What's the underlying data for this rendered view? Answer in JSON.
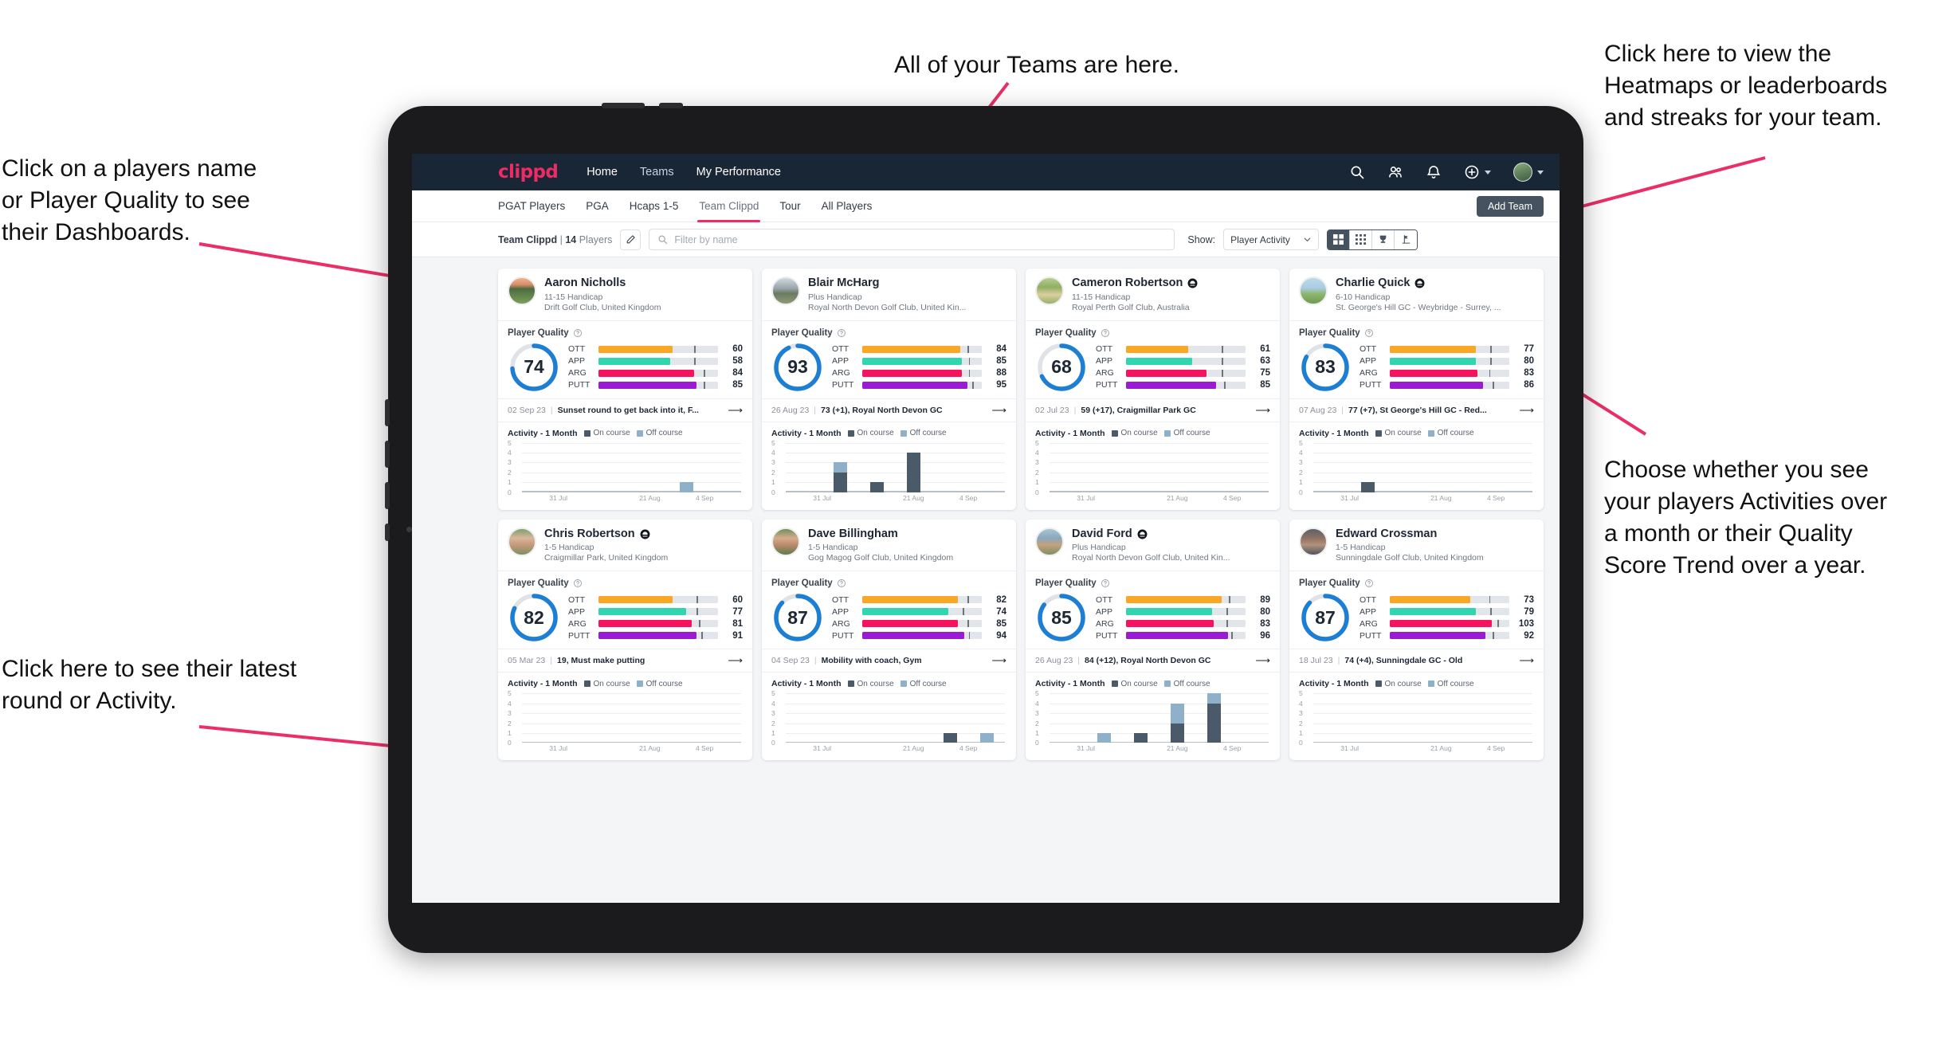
{
  "annotations": {
    "players": "Click on a players name\nor Player Quality to see\ntheir Dashboards.",
    "latest": "Click here to see their latest\nround or Activity.",
    "teams": "All of your Teams are here.",
    "heatmap": "Click here to view the\nHeatmaps or leaderboards\nand streaks for your team.",
    "choose": "Choose whether you see\nyour players Activities over\na month or their Quality\nScore Trend over a year."
  },
  "colors": {
    "brand_pink": "#ee2b62",
    "navbar": "#182636",
    "ott": "#f9a825",
    "app": "#31d6b0",
    "arg": "#f5125f",
    "putt": "#9b1bd4",
    "ring": "#1d7fd4",
    "on_course": "#4a5a69",
    "off_course": "#8fb0c9"
  },
  "topnav": {
    "brand": "clippd",
    "links": [
      {
        "label": "Home",
        "active": true
      },
      {
        "label": "Teams",
        "active": false
      },
      {
        "label": "My Performance",
        "active": true
      }
    ],
    "icons": [
      "search-icon",
      "people-icon",
      "bell-icon",
      "plus-circle-icon",
      "avatar"
    ]
  },
  "subnav": {
    "tabs": [
      {
        "label": "PGAT Players",
        "active": false
      },
      {
        "label": "PGA",
        "active": false
      },
      {
        "label": "Hcaps 1-5",
        "active": false
      },
      {
        "label": "Team Clippd",
        "active": true
      },
      {
        "label": "Tour",
        "active": false
      },
      {
        "label": "All Players",
        "active": false
      }
    ],
    "add_team_label": "Add Team"
  },
  "filterbar": {
    "team_name": "Team Clippd",
    "separator": "|",
    "player_count": "14",
    "players_word": "Players",
    "edit_icon": "pencil-icon",
    "search_placeholder": "Filter by name",
    "show_label": "Show:",
    "show_value": "Player Activity",
    "view_modes": [
      {
        "name": "grid-large-view",
        "active": true
      },
      {
        "name": "grid-small-view",
        "active": false
      },
      {
        "name": "trophy-leaderboard-view",
        "active": false
      },
      {
        "name": "golf-flag-view",
        "active": false
      }
    ]
  },
  "card_labels": {
    "player_quality": "Player Quality",
    "activity_title": "Activity - 1 Month",
    "legend_on": "On course",
    "legend_off": "Off course",
    "bars": [
      "OTT",
      "APP",
      "ARG",
      "PUTT"
    ],
    "y_ticks": [
      "5",
      "4",
      "3",
      "2",
      "1",
      "0"
    ],
    "x_ticks": [
      "31 Jul",
      "21 Aug",
      "4 Sep"
    ]
  },
  "players": [
    {
      "name": "Aaron Nicholls",
      "verified": false,
      "handicap": "11-15 Handicap",
      "club": "Drift Golf Club, United Kingdom",
      "quality": 74,
      "metrics": [
        {
          "label": "OTT",
          "value": 60,
          "fill": 62,
          "tick": 80
        },
        {
          "label": "APP",
          "value": 58,
          "fill": 60,
          "tick": 80
        },
        {
          "label": "ARG",
          "value": 84,
          "fill": 80,
          "tick": 88
        },
        {
          "label": "PUTT",
          "value": 85,
          "fill": 82,
          "tick": 88
        }
      ],
      "latest_date": "02 Sep 23",
      "latest_text": "Sunset round to get back into it, F...",
      "activity": [
        {
          "on": 0,
          "off": 0
        },
        {
          "on": 0,
          "off": 0
        },
        {
          "on": 0,
          "off": 0
        },
        {
          "on": 0,
          "off": 0
        },
        {
          "on": 0,
          "off": 1
        },
        {
          "on": 0,
          "off": 0
        }
      ]
    },
    {
      "name": "Blair McHarg",
      "verified": false,
      "handicap": "Plus Handicap",
      "club": "Royal North Devon Golf Club, United Kin...",
      "quality": 93,
      "metrics": [
        {
          "label": "OTT",
          "value": 84,
          "fill": 82,
          "tick": 88
        },
        {
          "label": "APP",
          "value": 85,
          "fill": 83,
          "tick": 89
        },
        {
          "label": "ARG",
          "value": 88,
          "fill": 83,
          "tick": 89
        },
        {
          "label": "PUTT",
          "value": 95,
          "fill": 88,
          "tick": 92
        }
      ],
      "latest_date": "26 Aug 23",
      "latest_text": "73 (+1), Royal North Devon GC",
      "activity": [
        {
          "on": 0,
          "off": 0
        },
        {
          "on": 2,
          "off": 1
        },
        {
          "on": 1,
          "off": 0
        },
        {
          "on": 4,
          "off": 0
        },
        {
          "on": 0,
          "off": 0
        },
        {
          "on": 0,
          "off": 0
        }
      ]
    },
    {
      "name": "Cameron Robertson",
      "verified": true,
      "handicap": "11-15 Handicap",
      "club": "Royal Perth Golf Club, Australia",
      "quality": 68,
      "metrics": [
        {
          "label": "OTT",
          "value": 61,
          "fill": 52,
          "tick": 80
        },
        {
          "label": "APP",
          "value": 63,
          "fill": 55,
          "tick": 80
        },
        {
          "label": "ARG",
          "value": 75,
          "fill": 67,
          "tick": 80
        },
        {
          "label": "PUTT",
          "value": 85,
          "fill": 75,
          "tick": 82
        }
      ],
      "latest_date": "02 Jul 23",
      "latest_text": "59 (+17), Craigmillar Park GC",
      "activity": [
        {
          "on": 0,
          "off": 0
        },
        {
          "on": 0,
          "off": 0
        },
        {
          "on": 0,
          "off": 0
        },
        {
          "on": 0,
          "off": 0
        },
        {
          "on": 0,
          "off": 0
        },
        {
          "on": 0,
          "off": 0
        }
      ]
    },
    {
      "name": "Charlie Quick",
      "verified": true,
      "handicap": "6-10 Handicap",
      "club": "St. George's Hill GC - Weybridge - Surrey, ...",
      "quality": 83,
      "metrics": [
        {
          "label": "OTT",
          "value": 77,
          "fill": 72,
          "tick": 84
        },
        {
          "label": "APP",
          "value": 80,
          "fill": 72,
          "tick": 84
        },
        {
          "label": "ARG",
          "value": 83,
          "fill": 73,
          "tick": 83
        },
        {
          "label": "PUTT",
          "value": 86,
          "fill": 78,
          "tick": 86
        }
      ],
      "latest_date": "07 Aug 23",
      "latest_text": "77 (+7), St George's Hill GC - Red...",
      "activity": [
        {
          "on": 0,
          "off": 0
        },
        {
          "on": 1,
          "off": 0
        },
        {
          "on": 0,
          "off": 0
        },
        {
          "on": 0,
          "off": 0
        },
        {
          "on": 0,
          "off": 0
        },
        {
          "on": 0,
          "off": 0
        }
      ]
    },
    {
      "name": "Chris Robertson",
      "verified": true,
      "handicap": "1-5 Handicap",
      "club": "Craigmillar Park, United Kingdom",
      "quality": 82,
      "metrics": [
        {
          "label": "OTT",
          "value": 60,
          "fill": 62,
          "tick": 82
        },
        {
          "label": "APP",
          "value": 77,
          "fill": 73,
          "tick": 82
        },
        {
          "label": "ARG",
          "value": 81,
          "fill": 78,
          "tick": 84
        },
        {
          "label": "PUTT",
          "value": 91,
          "fill": 82,
          "tick": 86
        }
      ],
      "latest_date": "05 Mar 23",
      "latest_text": "19, Must make putting",
      "activity": [
        {
          "on": 0,
          "off": 0
        },
        {
          "on": 0,
          "off": 0
        },
        {
          "on": 0,
          "off": 0
        },
        {
          "on": 0,
          "off": 0
        },
        {
          "on": 0,
          "off": 0
        },
        {
          "on": 0,
          "off": 0
        }
      ]
    },
    {
      "name": "Dave Billingham",
      "verified": false,
      "handicap": "1-5 Handicap",
      "club": "Gog Magog Golf Club, United Kingdom",
      "quality": 87,
      "metrics": [
        {
          "label": "OTT",
          "value": 82,
          "fill": 80,
          "tick": 88
        },
        {
          "label": "APP",
          "value": 74,
          "fill": 72,
          "tick": 84
        },
        {
          "label": "ARG",
          "value": 85,
          "fill": 80,
          "tick": 88
        },
        {
          "label": "PUTT",
          "value": 94,
          "fill": 85,
          "tick": 89
        }
      ],
      "latest_date": "04 Sep 23",
      "latest_text": "Mobility with coach, Gym",
      "activity": [
        {
          "on": 0,
          "off": 0
        },
        {
          "on": 0,
          "off": 0
        },
        {
          "on": 0,
          "off": 0
        },
        {
          "on": 0,
          "off": 0
        },
        {
          "on": 1,
          "off": 0
        },
        {
          "on": 0,
          "off": 1
        }
      ]
    },
    {
      "name": "David Ford",
      "verified": true,
      "handicap": "Plus Handicap",
      "club": "Royal North Devon Golf Club, United Kin...",
      "quality": 85,
      "metrics": [
        {
          "label": "OTT",
          "value": 89,
          "fill": 80,
          "tick": 86
        },
        {
          "label": "APP",
          "value": 80,
          "fill": 72,
          "tick": 84
        },
        {
          "label": "ARG",
          "value": 83,
          "fill": 73,
          "tick": 84
        },
        {
          "label": "PUTT",
          "value": 96,
          "fill": 85,
          "tick": 88
        }
      ],
      "latest_date": "26 Aug 23",
      "latest_text": "84 (+12), Royal North Devon GC",
      "activity": [
        {
          "on": 0,
          "off": 0
        },
        {
          "on": 0,
          "off": 1
        },
        {
          "on": 1,
          "off": 0
        },
        {
          "on": 2,
          "off": 2
        },
        {
          "on": 4,
          "off": 1
        },
        {
          "on": 0,
          "off": 0
        }
      ]
    },
    {
      "name": "Edward Crossman",
      "verified": false,
      "handicap": "1-5 Handicap",
      "club": "Sunningdale Golf Club, United Kingdom",
      "quality": 87,
      "metrics": [
        {
          "label": "OTT",
          "value": 73,
          "fill": 67,
          "tick": 83
        },
        {
          "label": "APP",
          "value": 79,
          "fill": 72,
          "tick": 84
        },
        {
          "label": "ARG",
          "value": 103,
          "fill": 85,
          "tick": 90
        },
        {
          "label": "PUTT",
          "value": 92,
          "fill": 80,
          "tick": 86
        }
      ],
      "latest_date": "18 Jul 23",
      "latest_text": "74 (+4), Sunningdale GC - Old",
      "activity": [
        {
          "on": 0,
          "off": 0
        },
        {
          "on": 0,
          "off": 0
        },
        {
          "on": 0,
          "off": 0
        },
        {
          "on": 0,
          "off": 0
        },
        {
          "on": 0,
          "off": 0
        },
        {
          "on": 0,
          "off": 0
        }
      ]
    }
  ]
}
